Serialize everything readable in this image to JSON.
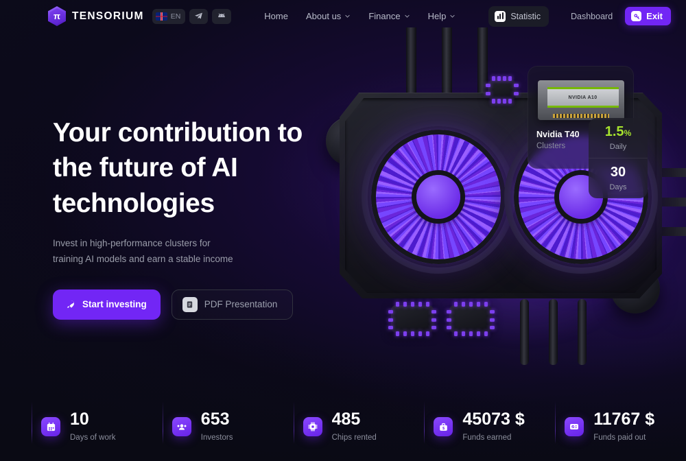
{
  "brand": {
    "name": "TENSORIUM",
    "logo_glyph": "π",
    "accent": "#7226f5"
  },
  "header": {
    "lang": {
      "code": "EN",
      "flag": "uk-flag-icon"
    },
    "socials": [
      {
        "name": "telegram-icon"
      },
      {
        "name": "android-icon"
      }
    ],
    "nav": [
      {
        "label": "Home",
        "caret": false
      },
      {
        "label": "About us",
        "caret": true
      },
      {
        "label": "Finance",
        "caret": true
      },
      {
        "label": "Help",
        "caret": true
      }
    ],
    "statistic_label": "Statistic",
    "dashboard_label": "Dashboard",
    "exit_label": "Exit"
  },
  "hero": {
    "title_line1": "Your contribution to",
    "title_line2": "the future of AI",
    "title_line3": "technologies",
    "subtitle_line1": "Invest in high-performance clusters for",
    "subtitle_line2": "training AI models and earn a stable income",
    "primary_cta": "Start investing",
    "secondary_cta": "PDF Presentation"
  },
  "gpu_card": {
    "image_label": "NVIDIA A10",
    "title": "Nvidia T40",
    "subtitle": "Clusters",
    "metrics": [
      {
        "value": "1.5",
        "unit": "%",
        "label": "Daily",
        "color": "#a6e22e"
      },
      {
        "value": "30",
        "unit": "",
        "label": "Days",
        "color": "#ffffff"
      }
    ]
  },
  "stats": [
    {
      "icon": "calendar-icon",
      "value": "10",
      "label": "Days of work"
    },
    {
      "icon": "investors-icon",
      "value": "653",
      "label": "Investors"
    },
    {
      "icon": "chip-icon",
      "value": "485",
      "label": "Chips rented"
    },
    {
      "icon": "briefcase-dollar-icon",
      "value": "45073 $",
      "label": "Funds earned"
    },
    {
      "icon": "payout-icon",
      "value": "11767 $",
      "label": "Funds paid out"
    }
  ]
}
